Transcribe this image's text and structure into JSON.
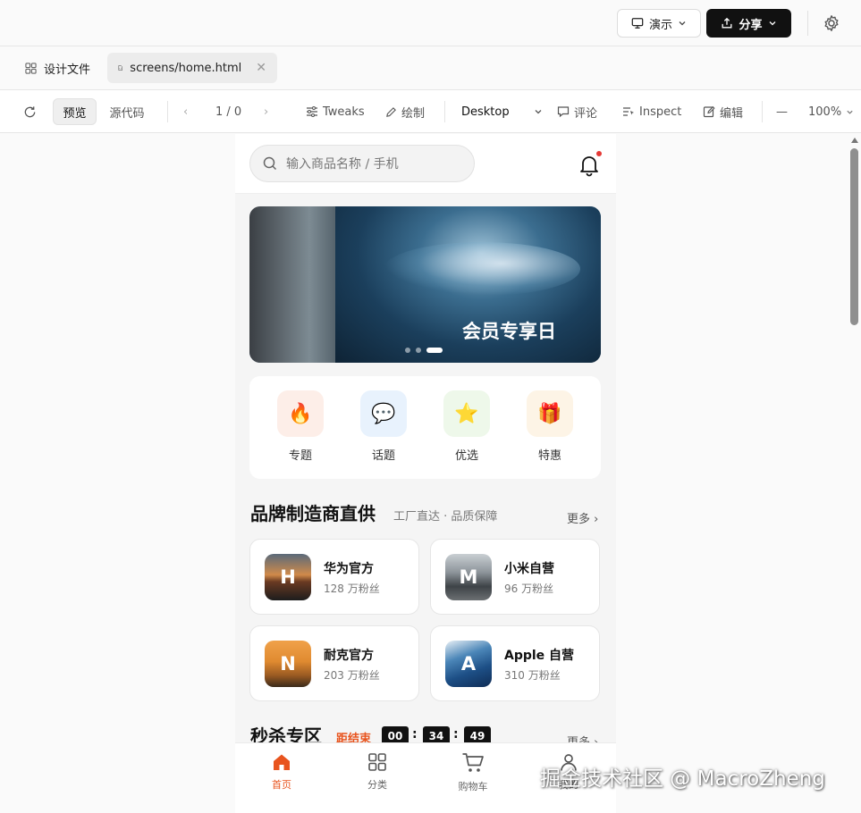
{
  "topbar": {
    "present_label": "演示",
    "share_label": "分享"
  },
  "tabs": {
    "files_label": "设计文件",
    "active_label": "screens/home.html"
  },
  "toolbar": {
    "preview_label": "预览",
    "source_label": "源代码",
    "page_indicator": "1 / 0",
    "tweaks_label": "Tweaks",
    "draw_label": "绘制",
    "viewport_value": "Desktop",
    "comment_label": "评论",
    "inspect_label": "Inspect",
    "edit_label": "编辑",
    "zoom_value": "100%"
  },
  "phone": {
    "search_placeholder": "输入商品名称 / 手机",
    "banner": {
      "title": "会员专享日",
      "slide_count": 3,
      "active_slide": 3
    },
    "quick_links": [
      {
        "label": "专题",
        "icon": "flame-icon",
        "emoji": "🔥",
        "bg": "#fdeee8"
      },
      {
        "label": "话题",
        "icon": "speech-bubble-icon",
        "emoji": "💬",
        "bg": "#e8f2fd"
      },
      {
        "label": "优选",
        "icon": "star-icon",
        "emoji": "⭐",
        "bg": "#eef8ea"
      },
      {
        "label": "特惠",
        "icon": "gift-icon",
        "emoji": "🎁",
        "bg": "#fdf4e6"
      }
    ],
    "brand_section": {
      "title": "品牌制造商直供",
      "subtitle": "工厂直达 · 品质保障",
      "more_label": "更多 ›",
      "brands": [
        {
          "initial": "H",
          "name": "华为官方",
          "fans": "128 万粉丝"
        },
        {
          "initial": "M",
          "name": "小米自营",
          "fans": "96 万粉丝"
        },
        {
          "initial": "N",
          "name": "耐克官方",
          "fans": "203 万粉丝"
        },
        {
          "initial": "A",
          "name": "Apple 自营",
          "fans": "310 万粉丝"
        }
      ]
    },
    "flash_section": {
      "title": "秒杀专区",
      "countdown_label": "距结束",
      "hours": "00",
      "minutes": "34",
      "seconds": "49",
      "more_label": "更多 ›"
    },
    "bottom_nav": [
      {
        "label": "首页"
      },
      {
        "label": "分类"
      },
      {
        "label": "购物车"
      },
      {
        "label": "我的"
      }
    ]
  },
  "watermark": "掘金技术社区 @ MacroZheng",
  "colors": {
    "accent": "#e8541e",
    "share_bg": "#111111",
    "notify_dot": "#e53935"
  }
}
